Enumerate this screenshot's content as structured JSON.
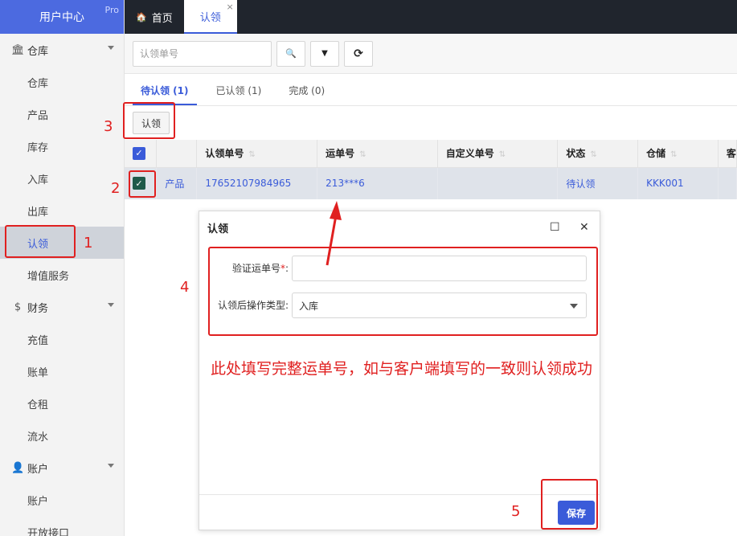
{
  "sidebar": {
    "brand": "用户中心",
    "pro": "Pro",
    "groups": [
      {
        "label": "仓库",
        "icon": "bank-icon",
        "items": [
          "仓库",
          "产品",
          "库存",
          "入库",
          "出库",
          "认领",
          "增值服务"
        ]
      },
      {
        "label": "财务",
        "icon": "dollar-icon",
        "items": [
          "充值",
          "账单",
          "仓租",
          "流水"
        ]
      },
      {
        "label": "账户",
        "icon": "user-icon",
        "items": [
          "账户",
          "开放接口"
        ]
      }
    ],
    "active_item": "认领"
  },
  "topbar": {
    "tabs": [
      {
        "label": "首页",
        "icon": "home-icon"
      },
      {
        "label": "认领",
        "active": true,
        "close": "×"
      }
    ]
  },
  "search": {
    "placeholder": "认领单号",
    "buttons": [
      "search-icon",
      "filter-icon",
      "refresh-icon"
    ],
    "search_glyph": "🔍",
    "filter_glyph": "▼",
    "refresh_glyph": "⟳"
  },
  "content_tabs": [
    "待认领 (1)",
    "已认领 (1)",
    "完成 (0)"
  ],
  "claim_button": "认领",
  "table": {
    "columns": [
      "认领单号",
      "运单号",
      "自定义单号",
      "状态",
      "仓储",
      "客"
    ],
    "rows": [
      {
        "type": "产品",
        "claim_no": "17652107984965",
        "waybill": "213***6",
        "custom_no": "",
        "status": "待认领",
        "warehouse": "KKK001"
      }
    ]
  },
  "dialog": {
    "title": "认领",
    "field1_label": "验证运单号",
    "field1_required": "*",
    "field1_colon": ":",
    "field1_value": "",
    "field2_label": "认领后操作类型:",
    "field2_value": "入库",
    "note": "此处填写完整运单号，如与客户端填写的一致则认领成功",
    "save_label": "保存",
    "maximize_glyph": "☐",
    "close_glyph": "✕"
  },
  "annotations": [
    "1",
    "2",
    "3",
    "4",
    "5"
  ],
  "colors": {
    "accent": "#3a5bd9",
    "annotation": "#e02020",
    "topbar": "#20252d"
  }
}
